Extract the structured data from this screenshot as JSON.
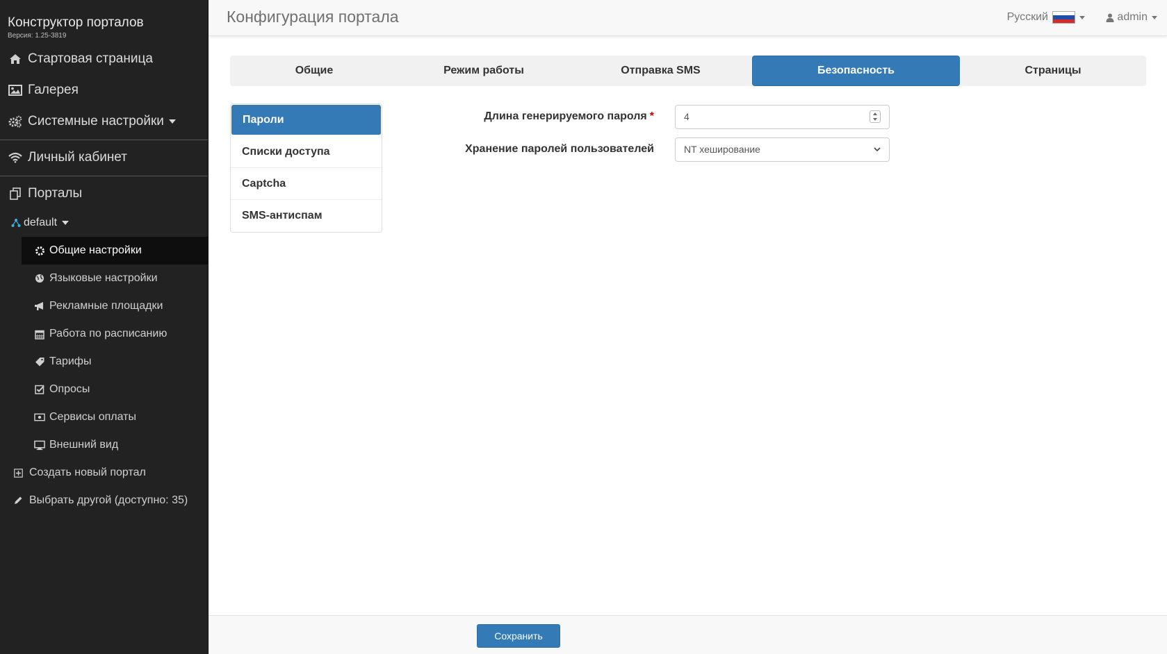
{
  "sidebar": {
    "brand_title": "Конструктор порталов",
    "brand_version": "Версия: 1.25-3819",
    "main_items": [
      {
        "label": "Стартовая страница",
        "icon": "home-icon"
      },
      {
        "label": "Галерея",
        "icon": "image-icon"
      },
      {
        "label": "Системные настройки",
        "icon": "cogs-icon"
      }
    ],
    "cabinet_label": "Личный кабинет",
    "portals_label": "Порталы",
    "portal_name": "default",
    "portal_items": [
      {
        "label": "Общие настройки",
        "icon": "gear-icon",
        "active": true
      },
      {
        "label": "Языковые настройки",
        "icon": "globe-icon"
      },
      {
        "label": "Рекламные площадки",
        "icon": "bullhorn-icon"
      },
      {
        "label": "Работа по расписанию",
        "icon": "calendar-icon"
      },
      {
        "label": "Тарифы",
        "icon": "tag-icon"
      },
      {
        "label": "Опросы",
        "icon": "check-square-icon"
      },
      {
        "label": "Сервисы оплаты",
        "icon": "money-icon"
      },
      {
        "label": "Внешний вид",
        "icon": "monitor-icon"
      }
    ],
    "create_portal_label": "Создать новый портал",
    "choose_other_label": "Выбрать другой (доступно: 35)"
  },
  "header": {
    "title": "Конфигурация портала",
    "language": "Русский",
    "user": "admin"
  },
  "tabs": [
    {
      "label": "Общие"
    },
    {
      "label": "Режим работы"
    },
    {
      "label": "Отправка SMS"
    },
    {
      "label": "Безопасность",
      "active": true
    },
    {
      "label": "Страницы"
    }
  ],
  "security_nav": [
    {
      "label": "Пароли",
      "active": true
    },
    {
      "label": "Списки доступа"
    },
    {
      "label": "Captcha"
    },
    {
      "label": "SMS-антиспам"
    }
  ],
  "form": {
    "password_length_label": "Длина генерируемого пароля",
    "required_mark": "*",
    "password_length_value": "4",
    "storage_label": "Хранение паролей пользователей",
    "storage_value": "NT хеширование"
  },
  "footer": {
    "save_label": "Сохранить"
  },
  "colors": {
    "accent": "#337ab7",
    "sidebar_bg": "#222222",
    "required": "#cc0000"
  }
}
